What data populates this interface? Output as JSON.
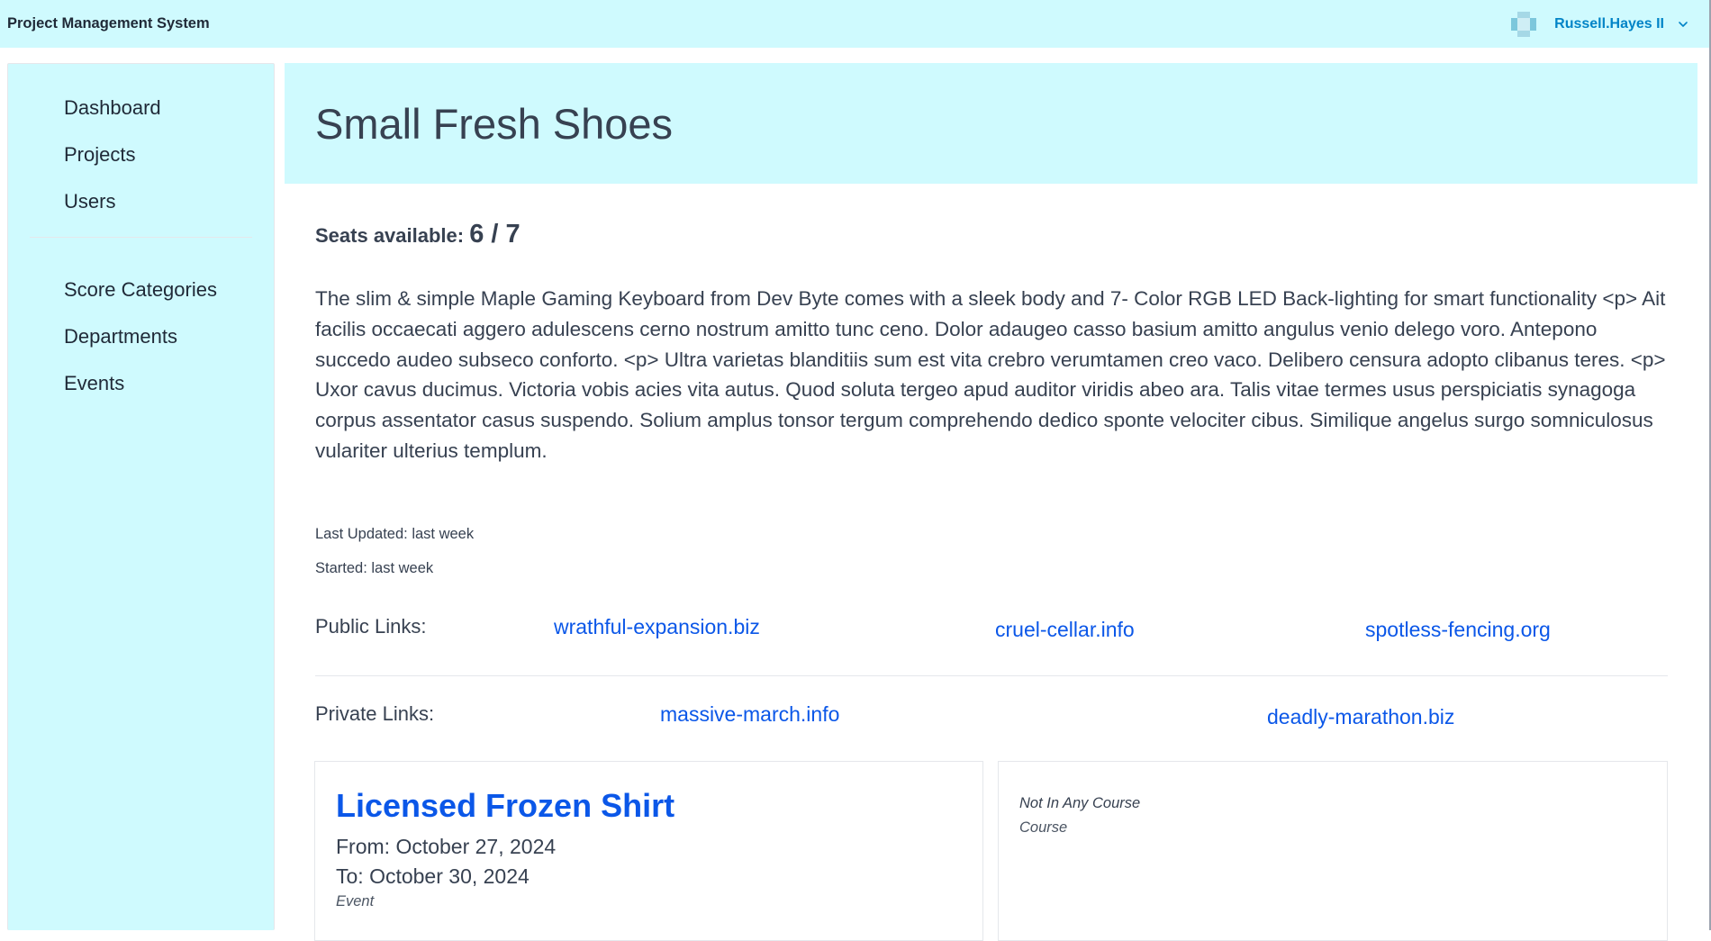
{
  "app": {
    "title": "Project Management System"
  },
  "user": {
    "name": "Russell.Hayes II"
  },
  "sidebar": {
    "primary": [
      {
        "label": "Dashboard"
      },
      {
        "label": "Projects"
      },
      {
        "label": "Users"
      }
    ],
    "secondary": [
      {
        "label": "Score Categories"
      },
      {
        "label": "Departments"
      },
      {
        "label": "Events"
      }
    ]
  },
  "project": {
    "title": "Small Fresh Shoes",
    "seats_label": "Seats available:",
    "seats_value": "6 / 7",
    "description": "The slim & simple Maple Gaming Keyboard from Dev Byte comes with a sleek body and 7- Color RGB LED Back-lighting for smart functionality <p> Ait facilis occaecati aggero adulescens cerno nostrum amitto tunc ceno. Dolor adaugeo casso basium amitto angulus venio delego voro. Antepono succedo audeo subseco conforto. <p> Ultra varietas blanditiis sum est vita crebro verumtamen creo vaco. Delibero censura adopto clibanus teres. <p> Uxor cavus ducimus. Victoria vobis acies vita autus. Quod soluta tergeo apud auditor viridis abeo ara. Talis vitae termes usus perspiciatis synagoga corpus assentator casus suspendo. Solium amplus tonsor tergum comprehendo dedico sponte velociter cibus. Similique angelus surgo somniculosus vulariter ulterius templum.",
    "last_updated": "Last Updated: last week",
    "started": "Started: last week",
    "public_links_label": "Public Links:",
    "public_links": [
      "wrathful-expansion.biz",
      "cruel-cellar.info",
      "spotless-fencing.org"
    ],
    "private_links_label": "Private Links:",
    "private_links": [
      "massive-march.info",
      "deadly-marathon.biz"
    ]
  },
  "event_card": {
    "title": "Licensed Frozen Shirt",
    "from": "From: October 27, 2024",
    "to": "To: October 30, 2024",
    "kind": "Event"
  },
  "course_card": {
    "value": "Not In Any Course",
    "kind": "Course"
  },
  "colors": {
    "accent_bg": "#cffafe",
    "link": "#0b57e8",
    "user_link": "#0284c7"
  }
}
